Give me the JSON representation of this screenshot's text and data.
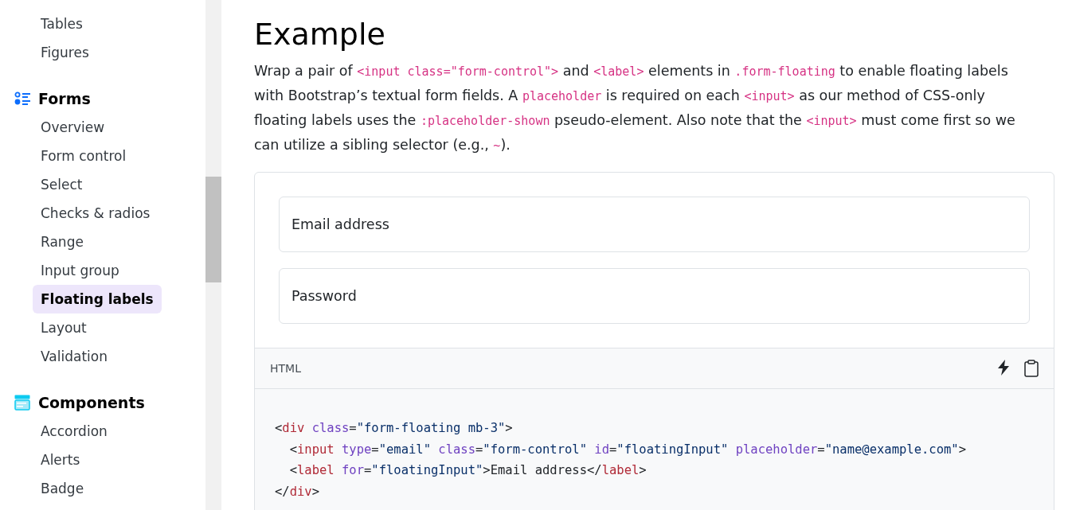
{
  "sidebar": {
    "groups": [
      {
        "items": [
          {
            "label": "Tables",
            "selected": false
          },
          {
            "label": "Figures",
            "selected": false
          }
        ]
      },
      {
        "title": "Forms",
        "items": [
          {
            "label": "Overview",
            "selected": false
          },
          {
            "label": "Form control",
            "selected": false
          },
          {
            "label": "Select",
            "selected": false
          },
          {
            "label": "Checks & radios",
            "selected": false
          },
          {
            "label": "Range",
            "selected": false
          },
          {
            "label": "Input group",
            "selected": false
          },
          {
            "label": "Floating labels",
            "selected": true
          },
          {
            "label": "Layout",
            "selected": false
          },
          {
            "label": "Validation",
            "selected": false
          }
        ]
      },
      {
        "title": "Components",
        "items": [
          {
            "label": "Accordion",
            "selected": false
          },
          {
            "label": "Alerts",
            "selected": false
          },
          {
            "label": "Badge",
            "selected": false
          }
        ]
      }
    ]
  },
  "heading": "Example",
  "paragraph": [
    {
      "kind": "text",
      "text": "Wrap a pair of "
    },
    {
      "kind": "code",
      "text": "<input class=\"form-control\">"
    },
    {
      "kind": "text",
      "text": " and "
    },
    {
      "kind": "code",
      "text": "<label>"
    },
    {
      "kind": "text",
      "text": " elements in "
    },
    {
      "kind": "code",
      "text": ".form-floating"
    },
    {
      "kind": "text",
      "text": " to enable floating labels with Bootstrap’s textual form fields. A "
    },
    {
      "kind": "code",
      "text": "placeholder"
    },
    {
      "kind": "text",
      "text": " is required on each "
    },
    {
      "kind": "code",
      "text": "<input>"
    },
    {
      "kind": "text",
      "text": " as our method of CSS-only floating labels uses the "
    },
    {
      "kind": "code",
      "text": ":placeholder-shown"
    },
    {
      "kind": "text",
      "text": " pseudo-element. Also note that the "
    },
    {
      "kind": "code",
      "text": "<input>"
    },
    {
      "kind": "text",
      "text": " must come first so we can utilize a sibling selector (e.g., "
    },
    {
      "kind": "code",
      "text": "~"
    },
    {
      "kind": "text",
      "text": ")."
    }
  ],
  "example": {
    "fields": [
      {
        "placeholder": "Email address"
      },
      {
        "placeholder": "Password"
      }
    ],
    "toolbar": {
      "language": "HTML"
    },
    "code": [
      [
        {
          "kind": "punct",
          "text": "<"
        },
        {
          "kind": "tag",
          "text": "div"
        },
        {
          "kind": "attr",
          "text": " class"
        },
        {
          "kind": "punct",
          "text": "="
        },
        {
          "kind": "string",
          "text": "\"form-floating mb-3\""
        },
        {
          "kind": "punct",
          "text": ">"
        }
      ],
      [
        {
          "kind": "punct",
          "text": "  <"
        },
        {
          "kind": "tag",
          "text": "input"
        },
        {
          "kind": "attr",
          "text": " type"
        },
        {
          "kind": "punct",
          "text": "="
        },
        {
          "kind": "string",
          "text": "\"email\""
        },
        {
          "kind": "attr",
          "text": " class"
        },
        {
          "kind": "punct",
          "text": "="
        },
        {
          "kind": "string",
          "text": "\"form-control\""
        },
        {
          "kind": "attr",
          "text": " id"
        },
        {
          "kind": "punct",
          "text": "="
        },
        {
          "kind": "string",
          "text": "\"floatingInput\""
        },
        {
          "kind": "attr",
          "text": " placeholder"
        },
        {
          "kind": "punct",
          "text": "="
        },
        {
          "kind": "string",
          "text": "\"name@example.com\""
        },
        {
          "kind": "punct",
          "text": ">"
        }
      ],
      [
        {
          "kind": "punct",
          "text": "  <"
        },
        {
          "kind": "tag",
          "text": "label"
        },
        {
          "kind": "attr",
          "text": " for"
        },
        {
          "kind": "punct",
          "text": "="
        },
        {
          "kind": "string",
          "text": "\"floatingInput\""
        },
        {
          "kind": "punct",
          "text": ">Email address</"
        },
        {
          "kind": "tag",
          "text": "label"
        },
        {
          "kind": "punct",
          "text": ">"
        }
      ],
      [
        {
          "kind": "punct",
          "text": "</"
        },
        {
          "kind": "tag",
          "text": "div"
        },
        {
          "kind": "punct",
          "text": ">"
        }
      ]
    ]
  }
}
